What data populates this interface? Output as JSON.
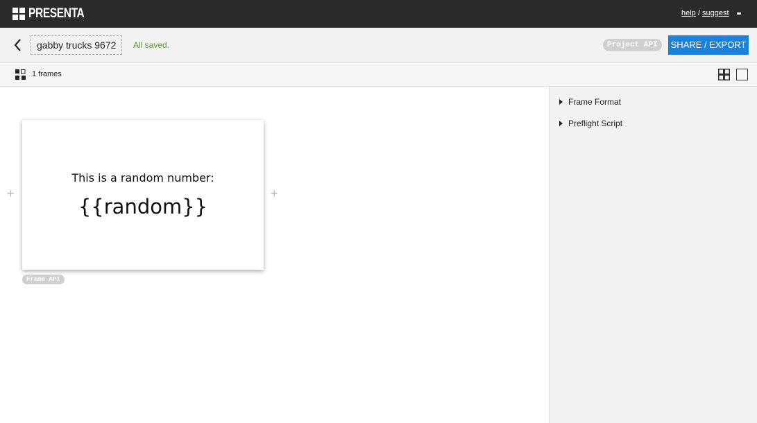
{
  "app": {
    "name": "PRESENTA"
  },
  "topbar": {
    "help_label": "help",
    "separator": " / ",
    "suggest_label": "suggest"
  },
  "project": {
    "name": "gabby trucks 9672",
    "status": "All saved.",
    "api_label": "Project API",
    "share_label": "SHARE / EXPORT"
  },
  "frames_bar": {
    "count_label": "1 frames"
  },
  "frame": {
    "line1": "This is a random number:",
    "line2": "{{random}}",
    "api_label": "Frame API"
  },
  "panel": {
    "items": [
      {
        "label": "Frame Format"
      },
      {
        "label": "Preflight Script"
      }
    ]
  },
  "colors": {
    "topbar": "#2b2b2b",
    "accent": "#1a82dc",
    "saved": "#5a9a2e"
  },
  "icons": [
    "presenta-logo-icon",
    "back-arrow-icon",
    "frames-layout-icon",
    "grid-view-icon",
    "single-view-icon",
    "add-frame-icon",
    "triangle-right-icon"
  ]
}
